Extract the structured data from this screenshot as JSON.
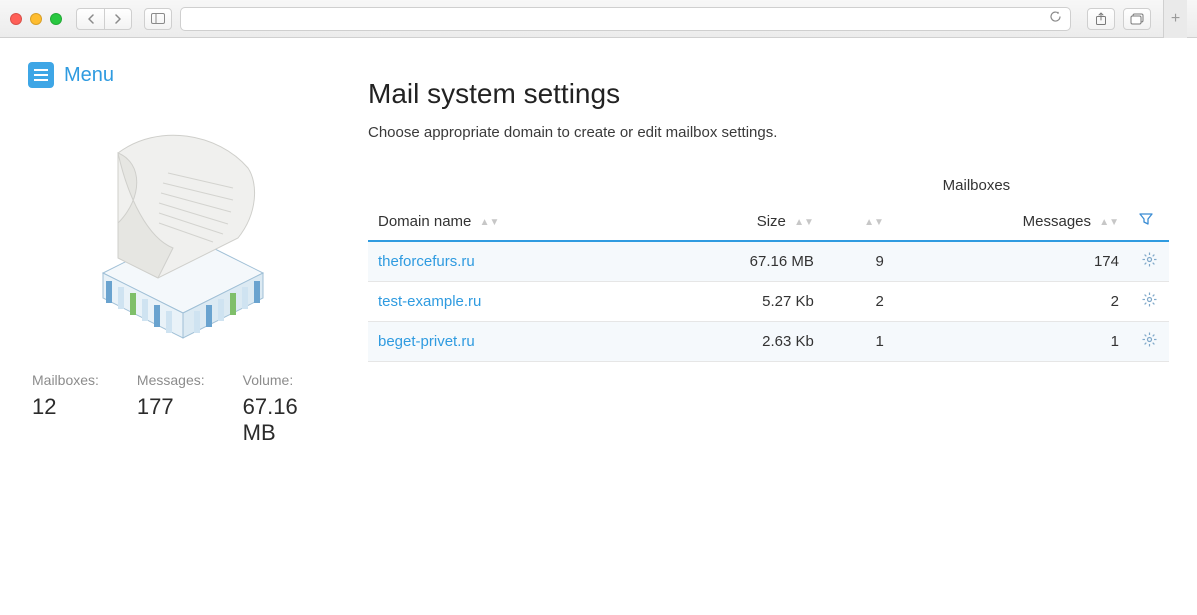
{
  "sidebar": {
    "menu_label": "Menu",
    "stats": {
      "mailboxes_label": "Mailboxes:",
      "mailboxes_value": "12",
      "messages_label": "Messages:",
      "messages_value": "177",
      "volume_label": "Volume:",
      "volume_value": "67.16 MB"
    }
  },
  "main": {
    "title": "Mail system settings",
    "subtitle": "Choose appropriate domain to create or edit mailbox settings.",
    "table": {
      "group_header": "Mailboxes",
      "col_domain": "Domain name",
      "col_size": "Size",
      "col_messages": "Messages",
      "rows": [
        {
          "domain": "theforcefurs.ru",
          "size": "67.16 MB",
          "mailboxes": "9",
          "messages": "174"
        },
        {
          "domain": "test-example.ru",
          "size": "5.27 Kb",
          "mailboxes": "2",
          "messages": "2"
        },
        {
          "domain": "beget-privet.ru",
          "size": "2.63 Kb",
          "mailboxes": "1",
          "messages": "1"
        }
      ]
    }
  }
}
